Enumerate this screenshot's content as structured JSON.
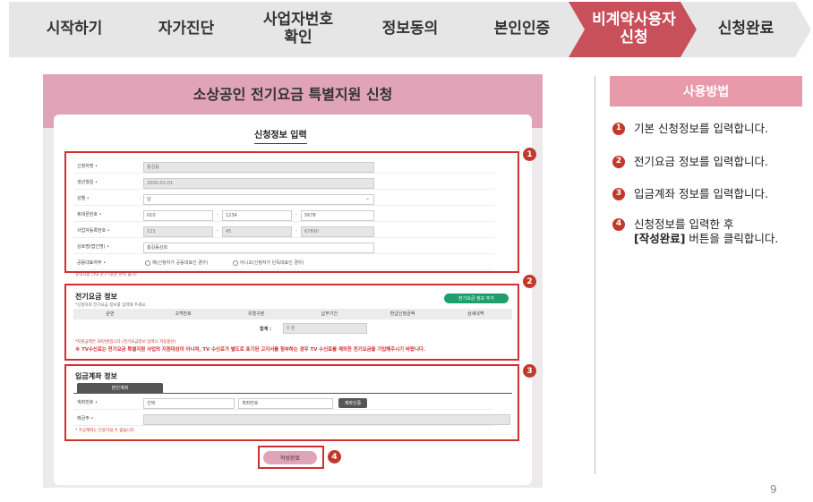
{
  "steps": [
    {
      "label": "시작하기",
      "color": "#e6e6e6",
      "active": false
    },
    {
      "label": "자가진단",
      "color": "#e6e6e6",
      "active": false
    },
    {
      "label": "사업자번호\n확인",
      "color": "#e6e6e6",
      "active": false
    },
    {
      "label": "정보동의",
      "color": "#e6e6e6",
      "active": false
    },
    {
      "label": "본인인증",
      "color": "#e6e6e6",
      "active": false
    },
    {
      "label": "비계약사용자\n신청",
      "color": "#c8505a",
      "active": true
    },
    {
      "label": "신청완료",
      "color": "#e6e6e6",
      "active": false
    }
  ],
  "form": {
    "header": "소상공인 전기요금 특별지원 신청",
    "title": "신청정보 입력",
    "fields": {
      "name_label": "신청자명",
      "name_value": "홍길동",
      "birth_label": "생년월일",
      "birth_value": "2000-01-01",
      "gender_label": "성별",
      "gender_value": "남",
      "phone_label": "휴대폰번호",
      "phone_1": "010",
      "phone_2": "1234",
      "phone_3": "5678",
      "bizno_label": "사업자등록번호",
      "bizno_1": "123",
      "bizno_2": "45",
      "bizno_3": "67890",
      "company_label": "상호명(법인명)",
      "company_value": "홍길동상회",
      "corp_label": "공동대표여부",
      "corp_opt1": "예(신청자가 공동대표인 경우)",
      "corp_opt2": "아니오(신청자가 단독대표인 경우)"
    },
    "note1": "유의사항 안내 문구 (원문 판독 불가)",
    "elec": {
      "title": "전기요금 정보",
      "desc": "*신청자의 전기요금 정보를 입력해 주세요.",
      "add_btn": "전기요금 정보 추가",
      "columns": [
        "순번",
        "고객번호",
        "유형구분",
        "납부기간",
        "환급신청금액",
        "상세내역"
      ],
      "total_label": "합계 :",
      "total_value": "0 원",
      "warn1": "*지원금액은 30만원입니다.(전기요금정보 입력시 자동합산)",
      "warn2": "※ TV수신료는 전기요금 특별지원 사업의 지원대상이 아니며, TV 수신료가 별도로 표기된 고지서를 첨부하는 경우 TV 수신료를 제외한 전기요",
      "warn3": "금을 기입해주시기 바랍니다."
    },
    "bank": {
      "title": "입금계좌 정보",
      "tab": "본인계좌",
      "acct_label": "계좌번호",
      "bank_select": "선택",
      "acct_placeholder": "계좌번호",
      "verify_btn": "계좌인증",
      "holder_label": "예금주",
      "note": "* 가상계좌는 인증하실 수 없습니다."
    },
    "submit": "작성완료",
    "badges": [
      "1",
      "2",
      "3",
      "4"
    ]
  },
  "help": {
    "title": "사용방법",
    "items": [
      {
        "num": "1",
        "text": "기본 신청정보를 입력합니다."
      },
      {
        "num": "2",
        "text": "전기요금 정보를 입력합니다."
      },
      {
        "num": "3",
        "text": "입금계좌 정보를 입력합니다."
      },
      {
        "num": "4",
        "text": "신청정보를 입력한 후",
        "text2": "[작성완료]",
        "text3": " 버튼을 클릭합니다."
      }
    ]
  },
  "page_number": "9",
  "colors": {
    "accent": "#c8505a",
    "frame": "#d32f2f",
    "badge": "#c0392b",
    "header_pink": "#e0a3b7",
    "help_pink": "#e89aaa",
    "green": "#1e9e6a"
  }
}
